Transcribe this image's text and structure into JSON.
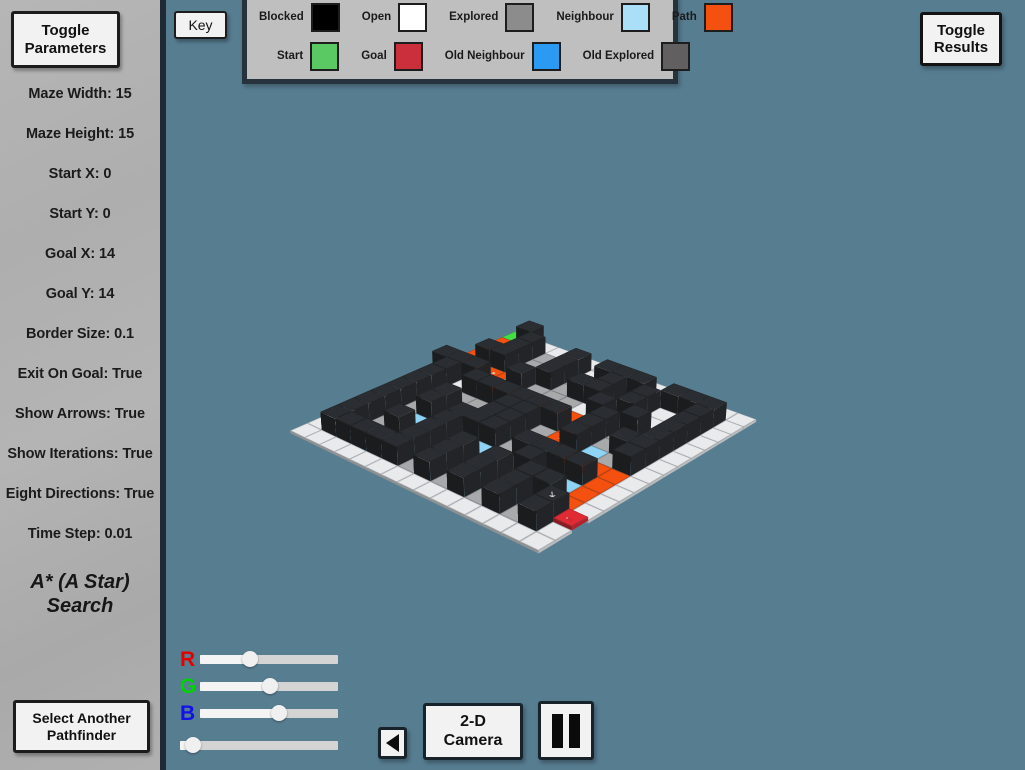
{
  "window": {
    "background_color": "#577d91",
    "sidebar_color": "#b3b3b3"
  },
  "sidebar": {
    "toggle_parameters_label": "Toggle\nParameters",
    "select_pathfinder_label": "Select Another\nPathfinder",
    "algorithm_name": "A* (A Star)\nSearch",
    "parameters": [
      {
        "label": "Maze Width: 15"
      },
      {
        "label": "Maze Height: 15"
      },
      {
        "label": "Start X: 0"
      },
      {
        "label": "Start Y: 0"
      },
      {
        "label": "Goal X: 14"
      },
      {
        "label": "Goal Y: 14"
      },
      {
        "label": "Border Size: 0.1"
      },
      {
        "label": "Exit On Goal: True"
      },
      {
        "label": "Show Arrows: True"
      },
      {
        "label": "Show Iterations: True"
      },
      {
        "label": "Eight Directions: True"
      },
      {
        "label": "Time Step: 0.01"
      }
    ]
  },
  "toolbar": {
    "key_button_label": "Key",
    "toggle_results_label": "Toggle\nResults"
  },
  "key_panel": {
    "row1": [
      {
        "label": "Blocked",
        "color": "#000000"
      },
      {
        "label": "Open",
        "color": "#ffffff"
      },
      {
        "label": "Explored",
        "color": "#8c8c8c"
      },
      {
        "label": "Neighbour",
        "color": "#aadff7"
      },
      {
        "label": "Path",
        "color": "#f4500f"
      }
    ],
    "row2": [
      {
        "label": "Start",
        "color": "#5bc963"
      },
      {
        "label": "Goal",
        "color": "#cc2f3c"
      },
      {
        "label": "Old Neighbour",
        "color": "#2b9af3"
      },
      {
        "label": "Old Explored",
        "color": "#615f5f"
      }
    ]
  },
  "controls": {
    "sliders": [
      {
        "name": "R",
        "color": "#e30000",
        "value": 36
      },
      {
        "name": "G",
        "color": "#00d400",
        "value": 51
      },
      {
        "name": "B",
        "color": "#1212e8",
        "value": 57
      },
      {
        "name": "",
        "color": "#ffffff",
        "value": 8
      }
    ],
    "prev_camera_label": "previous-camera",
    "camera_mode_label": "2-D\nCamera",
    "pause_label": "pause"
  },
  "maze": {
    "width": 15,
    "height": 15,
    "start": [
      0,
      0
    ],
    "goal": [
      14,
      14
    ],
    "colors": {
      "blocked": "#2a2d31",
      "open": "#e9eaec",
      "explored": "#a8a9ab",
      "neighbour": "#8fd4f5",
      "path": "#f4500f",
      "start": "#44dd44",
      "goal": "#e02b35",
      "old_neighbour": "#2b9af3",
      "old_explored": "#615f5f"
    },
    "legend_note": "3-D isometric grid of 15x15 cells; blocked cells raised as tall cubes, open/explored cells flat, A* path highlighted orange with directional arrows from start (green, top-left) to goal (red, right).",
    "cells": [
      "SBOOOOOOOOOOOOO",
      "POBEEBOBBBOBBBO",
      "PEBEOBEOBOBOEBO",
      "PBBEEBEBBOBOEBO",
      "PPPPBEEEOBEBOBO",
      "BBBPPPPPPPBEOBO",
      "OBOBBBBBBPBEBBO",
      "OBEEENBBEPBNEBO",
      "OBEBEEBBENPPPPO",
      "OBEBEBBBEBBBBPO",
      "OBENEBENEOBNNPO",
      "OBEBEBEBEBEBBPO",
      "OBNNEBEBEBEBEBG",
      "OBBBBBEBEBEBEBO",
      "OOOOOOOOOOOOOOO"
    ],
    "arrows": [
      {
        "row": 4,
        "col": 0,
        "glyph": "↑"
      },
      {
        "row": 3,
        "col": 0,
        "glyph": "↑"
      },
      {
        "row": 2,
        "col": 0,
        "glyph": "↑"
      },
      {
        "row": 4,
        "col": 2,
        "glyph": "↗"
      },
      {
        "row": 4,
        "col": 3,
        "glyph": "↗"
      },
      {
        "row": 5,
        "col": 4,
        "glyph": "↑"
      },
      {
        "row": 5,
        "col": 6,
        "glyph": "↑"
      },
      {
        "row": 7,
        "col": 9,
        "glyph": "↑"
      },
      {
        "row": 8,
        "col": 10,
        "glyph": "↗"
      },
      {
        "row": 8,
        "col": 11,
        "glyph": "→"
      },
      {
        "row": 8,
        "col": 12,
        "glyph": "→"
      },
      {
        "row": 12,
        "col": 13,
        "glyph": "↘"
      },
      {
        "row": 12,
        "col": 14,
        "glyph": "←"
      }
    ]
  }
}
